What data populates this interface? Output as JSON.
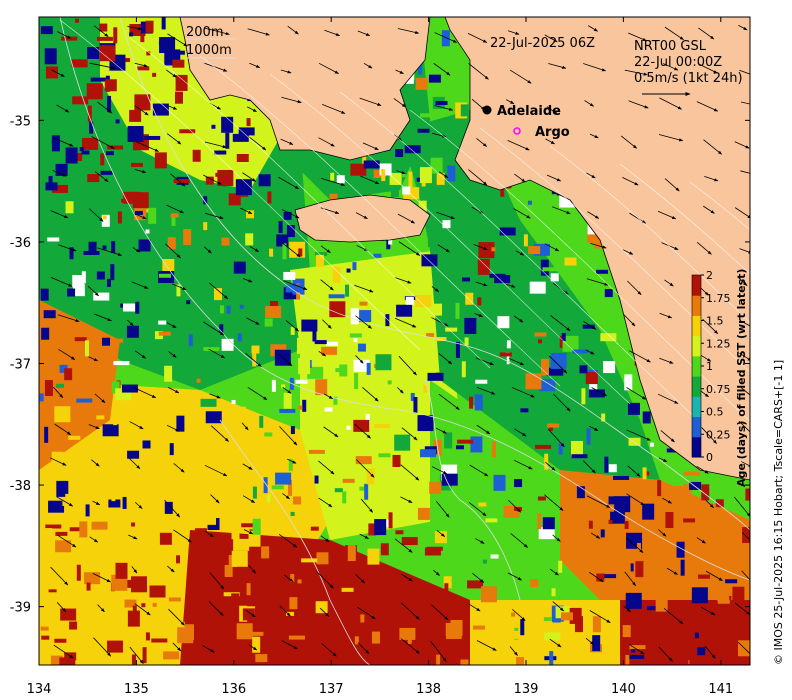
{
  "map": {
    "date_label": "22-Jul-2025 06Z",
    "current_info": [
      "NRT00 GSL",
      "22-Jul 00:00Z",
      "0.5m/s (1kt 24h)"
    ],
    "isobath_legend": [
      "200m",
      "1000m"
    ],
    "places": [
      {
        "name": "Adelaide",
        "lon": 138.6,
        "lat": -34.93,
        "marker": "filled-circle"
      },
      {
        "name": "Argo",
        "lon": 138.8,
        "lat": -35.13,
        "marker": "open-circle-magenta"
      }
    ],
    "lon_ticks": [
      "134",
      "135",
      "136",
      "137",
      "138",
      "139",
      "140",
      "141"
    ],
    "lat_ticks": [
      "-35",
      "-36",
      "-37",
      "-38",
      "-39"
    ],
    "lon_range": [
      134,
      141.3
    ],
    "lat_range": [
      -39.48,
      -34.15
    ],
    "credit": "© IMOS 25-Jul-2025 16:15 Hobart; Tscale=CARS+[-1 1]",
    "colors": {
      "land": "#f9c59c",
      "dot": "#000000",
      "argo": "#ff00ff"
    }
  },
  "colorbar": {
    "title": "Age (days) of filled SST (wrt latest)",
    "ticks": [
      "0",
      "0.25",
      "0.5",
      "0.75",
      "1",
      "1.25",
      "1.5",
      "1.75",
      "2"
    ],
    "range": [
      0,
      2
    ],
    "colors": [
      "#06068c",
      "#1f5fd6",
      "#19b5b0",
      "#12a83a",
      "#4ed81c",
      "#d2f41c",
      "#f6d20a",
      "#e87a0c",
      "#b01208"
    ]
  },
  "chart_data": {
    "type": "heatmap",
    "xlabel": "",
    "ylabel": "",
    "xlim": [
      134,
      141.3
    ],
    "ylim": [
      -39.48,
      -34.15
    ],
    "colorbar_label": "Age (days) of filled SST (wrt latest)",
    "colorbar_range": [
      0,
      2
    ]
  }
}
